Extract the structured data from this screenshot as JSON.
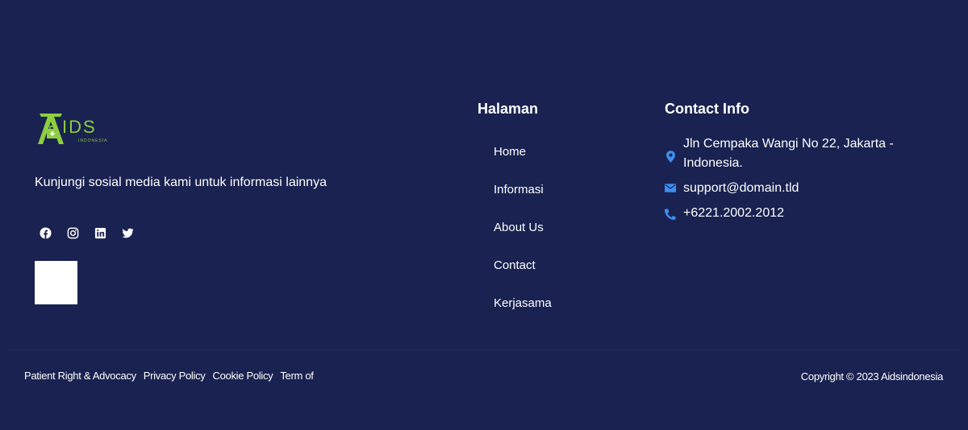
{
  "brand": {
    "logo_text": "IDS",
    "logo_sub": "INDONESIA",
    "logo_color": "#8ccf3f",
    "tagline": "Kunjungi sosial media kami untuk informasi lainnya"
  },
  "social": [
    {
      "icon": "facebook-icon"
    },
    {
      "icon": "instagram-icon"
    },
    {
      "icon": "linkedin-icon"
    },
    {
      "icon": "twitter-icon"
    }
  ],
  "halaman": {
    "title": "Halaman",
    "items": [
      {
        "label": "Home"
      },
      {
        "label": "Informasi"
      },
      {
        "label": "About Us"
      },
      {
        "label": "Contact"
      },
      {
        "label": "Kerjasama"
      }
    ]
  },
  "contact": {
    "title": "Contact Info",
    "address": "Jln Cempaka Wangi No 22, Jakarta - Indonesia.",
    "email": "support@domain.tld",
    "phone": "+6221.2002.2012",
    "icon_color": "#3b8ff0"
  },
  "legal_links": [
    {
      "label": "Patient Right & Advocacy"
    },
    {
      "label": "Privacy Policy"
    },
    {
      "label": "Cookie Policy"
    },
    {
      "label": "Term of"
    }
  ],
  "copyright": "Copyright © 2023 Aidsindonesia",
  "colors": {
    "background": "#192250",
    "text": "#ffffff"
  }
}
